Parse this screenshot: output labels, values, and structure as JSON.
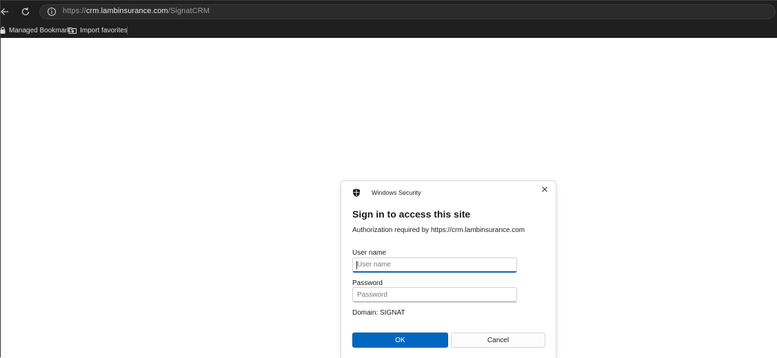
{
  "browser": {
    "url_scheme": "https://",
    "url_host": "crm.lambinsurance.com",
    "url_path": "/SignatCRM",
    "bookmarks": [
      {
        "label": "Managed Bookmarks",
        "icon": "lock-bookmark-icon"
      },
      {
        "label": "Import favorites",
        "icon": "import-folder-icon"
      }
    ],
    "icons": {
      "back": "arrow-left-icon",
      "refresh": "refresh-icon",
      "site_info": "info-circle-icon"
    }
  },
  "dialog": {
    "app_name": "Windows Security",
    "heading": "Sign in to access this site",
    "subtitle": "Authorization required by https://crm.lambinsurance.com",
    "username": {
      "label": "User name",
      "placeholder": "User name",
      "value": ""
    },
    "password": {
      "label": "Password",
      "placeholder": "Password",
      "value": ""
    },
    "domain": "Domain: SIGNAT",
    "ok_label": "OK",
    "cancel_label": "Cancel",
    "icons": {
      "shield": "shield-icon",
      "close": "close-icon"
    }
  },
  "colors": {
    "chrome_bg": "#1f1f1f",
    "accent": "#0067c0",
    "page_bg": "#ffffff"
  }
}
